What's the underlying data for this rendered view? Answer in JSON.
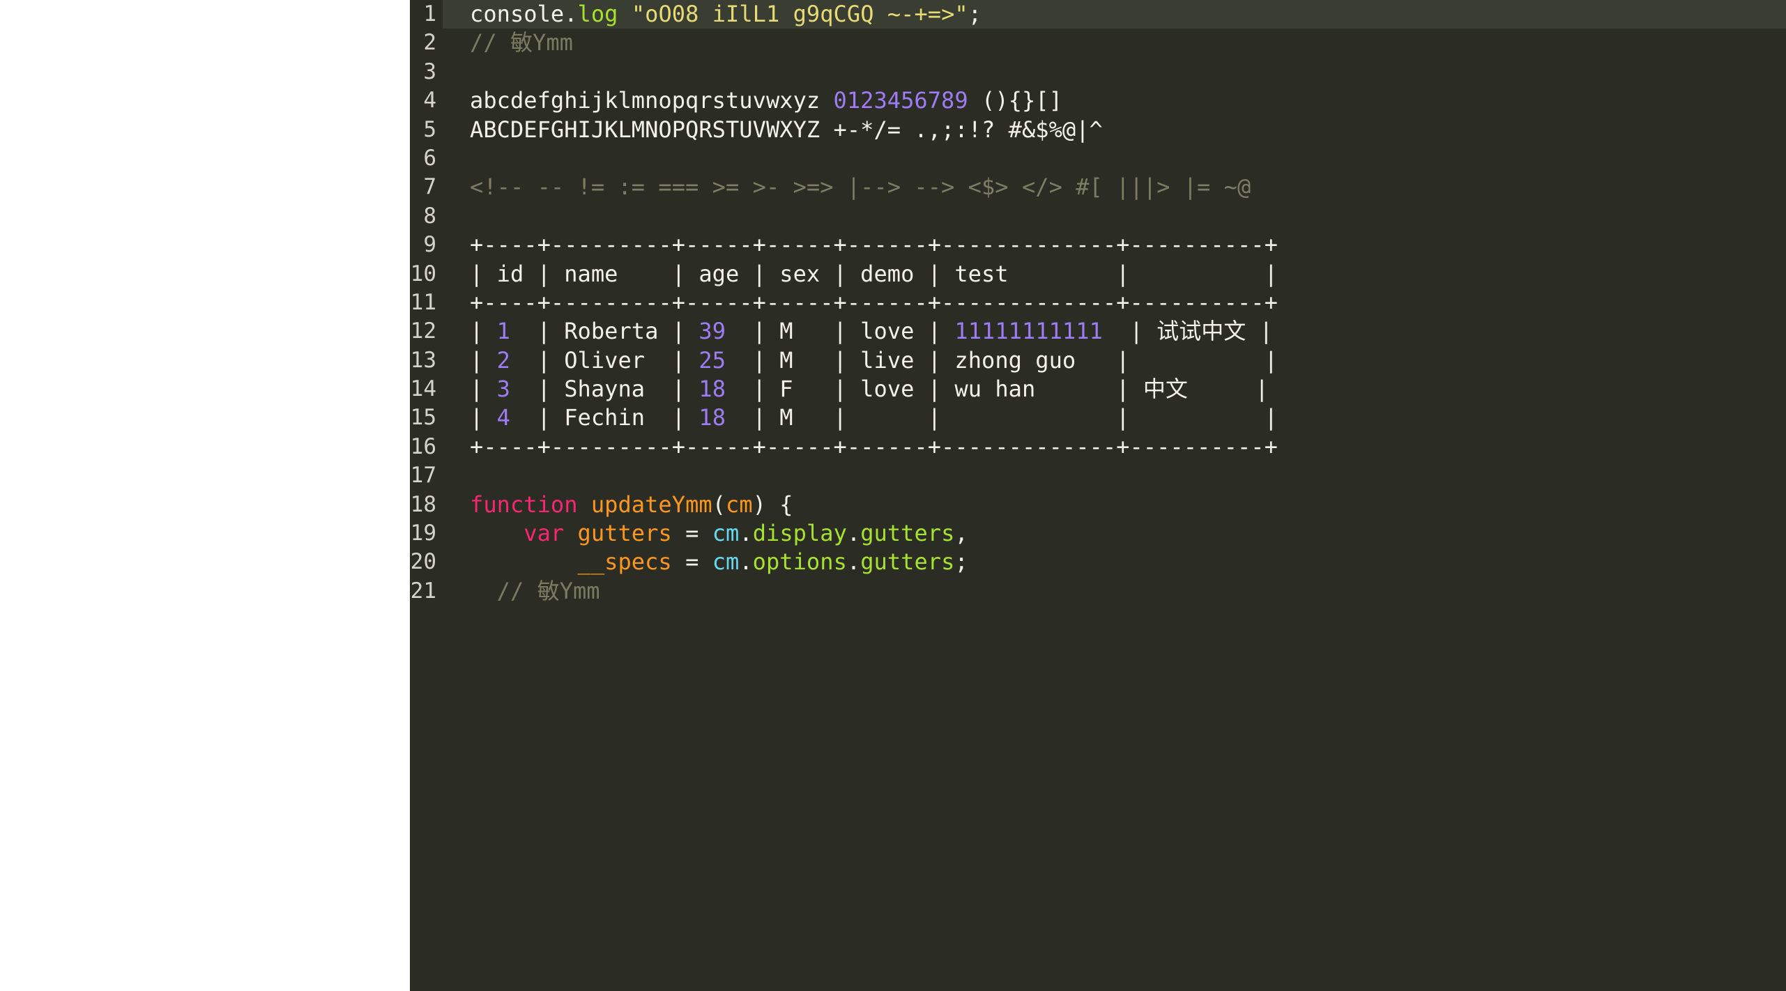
{
  "editor": {
    "theme_name": "monokai-dark",
    "background": "#2b2d24",
    "active_line_background": "#3a3d32",
    "gutter_text_color": "#d4d4cb",
    "active_line_number": 1,
    "colors": {
      "plain": "#f2f2ea",
      "string": "#e6db74",
      "function": "#a6e22e",
      "comment": "#7b7b62",
      "number": "#9d7cf4",
      "operator_ligature": "#7d7d66",
      "keyword": "#f92672",
      "variable": "#fd971f",
      "property": "#a6e22e",
      "cyan": "#66d9ef"
    },
    "line_numbers": [
      "1",
      "2",
      "3",
      "4",
      "5",
      "6",
      "7",
      "8",
      "9",
      "10",
      "11",
      "12",
      "13",
      "14",
      "15",
      "16",
      "17",
      "18",
      "19",
      "20",
      "21"
    ],
    "lines": [
      {
        "n": "1",
        "active": true,
        "tokens": [
          {
            "text": "console",
            "cls": "t-plain"
          },
          {
            "text": ".",
            "cls": "t-plain"
          },
          {
            "text": "log",
            "cls": "t-fn"
          },
          {
            "text": " ",
            "cls": "t-plain"
          },
          {
            "text": "\"oO08 iIlL1 g9qCGQ ~-+=>\"",
            "cls": "t-str"
          },
          {
            "text": ";",
            "cls": "t-plain"
          }
        ]
      },
      {
        "n": "2",
        "active": false,
        "tokens": [
          {
            "text": "// ",
            "cls": "t-comment"
          },
          {
            "text": "敏",
            "cls": "t-comment cjk"
          },
          {
            "text": "Ymm",
            "cls": "t-comment"
          }
        ]
      },
      {
        "n": "3",
        "active": false,
        "tokens": []
      },
      {
        "n": "4",
        "active": false,
        "tokens": [
          {
            "text": "abcdefghijklmnopqrstuvwxyz ",
            "cls": "t-plain"
          },
          {
            "text": "0123456789",
            "cls": "t-num"
          },
          {
            "text": " (){}[]",
            "cls": "t-plain"
          }
        ]
      },
      {
        "n": "5",
        "active": false,
        "tokens": [
          {
            "text": "ABCDEFGHIJKLMNOPQRSTUVWXYZ +-*/= .,;:!? #&$%@|^",
            "cls": "t-plain"
          }
        ]
      },
      {
        "n": "6",
        "active": false,
        "tokens": []
      },
      {
        "n": "7",
        "active": false,
        "tokens": [
          {
            "text": "<!-- -- != := === >= >- >=> |--> --> <$> </> #[ |||> |= ~@",
            "cls": "t-op"
          }
        ]
      },
      {
        "n": "8",
        "active": false,
        "tokens": []
      },
      {
        "n": "9",
        "active": false,
        "tokens": [
          {
            "text": "+----+---------+-----+-----+------+-------------+----------+",
            "cls": "t-plain"
          }
        ]
      },
      {
        "n": "10",
        "active": false,
        "tokens": [
          {
            "text": "| id | name    | age | sex | demo | test        |          |",
            "cls": "t-plain"
          }
        ]
      },
      {
        "n": "11",
        "active": false,
        "tokens": [
          {
            "text": "+----+---------+-----+-----+------+-------------+----------+",
            "cls": "t-plain"
          }
        ]
      },
      {
        "n": "12",
        "active": false,
        "tokens": [
          {
            "text": "| ",
            "cls": "t-plain"
          },
          {
            "text": "1",
            "cls": "t-num"
          },
          {
            "text": "  | Roberta | ",
            "cls": "t-plain"
          },
          {
            "text": "39",
            "cls": "t-num"
          },
          {
            "text": "  | M   | love | ",
            "cls": "t-plain"
          },
          {
            "text": "11111111111",
            "cls": "t-num"
          },
          {
            "text": "  | ",
            "cls": "t-plain"
          },
          {
            "text": "试试中文",
            "cls": "t-plain cjk"
          },
          {
            "text": " |",
            "cls": "t-plain"
          }
        ]
      },
      {
        "n": "13",
        "active": false,
        "tokens": [
          {
            "text": "| ",
            "cls": "t-plain"
          },
          {
            "text": "2",
            "cls": "t-num"
          },
          {
            "text": "  | Oliver  | ",
            "cls": "t-plain"
          },
          {
            "text": "25",
            "cls": "t-num"
          },
          {
            "text": "  | M   | live | zhong guo   |          |",
            "cls": "t-plain"
          }
        ]
      },
      {
        "n": "14",
        "active": false,
        "tokens": [
          {
            "text": "| ",
            "cls": "t-plain"
          },
          {
            "text": "3",
            "cls": "t-num"
          },
          {
            "text": "  | Shayna  | ",
            "cls": "t-plain"
          },
          {
            "text": "18",
            "cls": "t-num"
          },
          {
            "text": "  | F   | love | wu han      | ",
            "cls": "t-plain"
          },
          {
            "text": "中文",
            "cls": "t-plain cjk"
          },
          {
            "text": "     |",
            "cls": "t-plain"
          }
        ]
      },
      {
        "n": "15",
        "active": false,
        "tokens": [
          {
            "text": "| ",
            "cls": "t-plain"
          },
          {
            "text": "4",
            "cls": "t-num"
          },
          {
            "text": "  | Fechin  | ",
            "cls": "t-plain"
          },
          {
            "text": "18",
            "cls": "t-num"
          },
          {
            "text": "  | M   |      |             |          |",
            "cls": "t-plain"
          }
        ]
      },
      {
        "n": "16",
        "active": false,
        "tokens": [
          {
            "text": "+----+---------+-----+-----+------+-------------+----------+",
            "cls": "t-plain"
          }
        ]
      },
      {
        "n": "17",
        "active": false,
        "tokens": []
      },
      {
        "n": "18",
        "active": false,
        "tokens": [
          {
            "text": "function",
            "cls": "t-kw"
          },
          {
            "text": " ",
            "cls": "t-plain"
          },
          {
            "text": "updateYmm",
            "cls": "t-fn-orange"
          },
          {
            "text": "(",
            "cls": "t-plain"
          },
          {
            "text": "cm",
            "cls": "t-param"
          },
          {
            "text": ") {",
            "cls": "t-plain"
          }
        ]
      },
      {
        "n": "19",
        "active": false,
        "tokens": [
          {
            "text": "    ",
            "cls": "t-plain"
          },
          {
            "text": "var",
            "cls": "t-kw"
          },
          {
            "text": " ",
            "cls": "t-plain"
          },
          {
            "text": "gutters",
            "cls": "t-var"
          },
          {
            "text": " = ",
            "cls": "t-plain"
          },
          {
            "text": "cm",
            "cls": "t-cyan"
          },
          {
            "text": ".",
            "cls": "t-plain"
          },
          {
            "text": "display",
            "cls": "t-prop"
          },
          {
            "text": ".",
            "cls": "t-plain"
          },
          {
            "text": "gutters",
            "cls": "t-prop"
          },
          {
            "text": ",",
            "cls": "t-plain"
          }
        ]
      },
      {
        "n": "20",
        "active": false,
        "tokens": [
          {
            "text": "        ",
            "cls": "t-plain"
          },
          {
            "text": "__specs",
            "cls": "t-var"
          },
          {
            "text": " = ",
            "cls": "t-plain"
          },
          {
            "text": "cm",
            "cls": "t-cyan"
          },
          {
            "text": ".",
            "cls": "t-plain"
          },
          {
            "text": "options",
            "cls": "t-prop"
          },
          {
            "text": ".",
            "cls": "t-plain"
          },
          {
            "text": "gutters",
            "cls": "t-prop"
          },
          {
            "text": ";",
            "cls": "t-plain"
          }
        ]
      },
      {
        "n": "21",
        "active": false,
        "tokens": [
          {
            "text": "  // ",
            "cls": "t-comment"
          },
          {
            "text": "敏",
            "cls": "t-comment cjk"
          },
          {
            "text": "Ymm",
            "cls": "t-comment"
          }
        ]
      }
    ],
    "ascii_table": {
      "columns": [
        "id",
        "name",
        "age",
        "sex",
        "demo",
        "test",
        ""
      ],
      "rows": [
        [
          "1",
          "Roberta",
          "39",
          "M",
          "love",
          "11111111111",
          "试试中文"
        ],
        [
          "2",
          "Oliver",
          "25",
          "M",
          "live",
          "zhong guo",
          ""
        ],
        [
          "3",
          "Shayna",
          "18",
          "F",
          "love",
          "wu han",
          "中文"
        ],
        [
          "4",
          "Fechin",
          "18",
          "M",
          "",
          "",
          ""
        ]
      ]
    }
  }
}
